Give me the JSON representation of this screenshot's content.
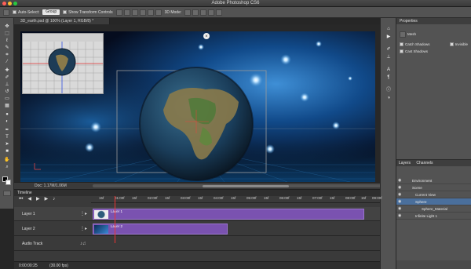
{
  "app": {
    "title": "Adobe Photoshop CS6",
    "window_dots": [
      "#ff5f57",
      "#ffbd2e",
      "#28c840"
    ]
  },
  "options_bar": {
    "auto_select_label": "Auto-Select:",
    "auto_select_value": "Group",
    "show_transform_label": "Show Transform Controls",
    "mode_label": "3D Mode:"
  },
  "document": {
    "tab_label": "3D_earth.psd @ 100% (Layer 1, RGB/8) *",
    "status_text": "Doc: 1.17M/1.06M"
  },
  "properties": {
    "header": "Properties",
    "mesh_label": "Mesh",
    "catch_shadows": "Catch Shadows",
    "cast_shadows": "Cast Shadows",
    "invisible_label": "Invisible"
  },
  "layers_panel": {
    "tabs": [
      "Layers",
      "Channels"
    ],
    "rows": [
      {
        "label": "Environment",
        "indent": 10
      },
      {
        "label": "Scene",
        "indent": 10
      },
      {
        "label": "Current View",
        "indent": 14
      },
      {
        "label": "Sphere",
        "indent": 14
      },
      {
        "label": "Sphere_Material",
        "indent": 22
      },
      {
        "label": "Infinite Light 1",
        "indent": 14
      }
    ]
  },
  "timeline": {
    "header": "Timeline",
    "ruler_ticks": [
      "15f",
      "01:00f",
      "15f",
      "02:00f",
      "15f",
      "03:00f",
      "15f",
      "04:00f",
      "15f",
      "05:00f",
      "15f",
      "06:00f",
      "15f",
      "07:00f",
      "15f",
      "08:00f",
      "15f",
      "09:00f"
    ],
    "tracks": [
      {
        "name": "Layer 1",
        "clip_label": "Layer 1"
      },
      {
        "name": "Layer 2",
        "clip_label": "Layer 2"
      },
      {
        "name": "Audio Track",
        "clip_label": ""
      }
    ],
    "current_time": "0:00:00:25",
    "fps": "(30.00 fps)"
  },
  "icons": {
    "tools": [
      "move-icon",
      "marquee-icon",
      "lasso-icon",
      "quick-select-icon",
      "crop-icon",
      "eyedropper-icon",
      "healing-icon",
      "brush-icon",
      "stamp-icon",
      "history-brush-icon",
      "eraser-icon",
      "gradient-icon",
      "blur-icon",
      "dodge-icon",
      "pen-icon",
      "type-icon",
      "path-select-icon",
      "shape-icon",
      "hand-icon",
      "zoom-icon"
    ]
  },
  "colors": {
    "clip_purple": "#7a52b0",
    "panel_gray": "#535353",
    "foreground_swatch": "#000000",
    "background_swatch": "#ffffff",
    "playhead": "#ee3333"
  }
}
